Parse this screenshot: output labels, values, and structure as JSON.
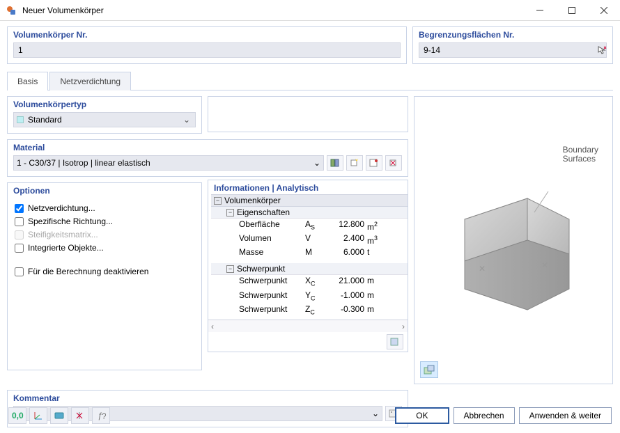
{
  "window": {
    "title": "Neuer Volumenkörper"
  },
  "top": {
    "nr_label": "Volumenkörper Nr.",
    "nr_value": "1",
    "surf_label": "Begrenzungsflächen Nr.",
    "surf_value": "9-14"
  },
  "tabs": {
    "basis": "Basis",
    "mesh": "Netzverdichtung"
  },
  "type": {
    "label": "Volumenkörpertyp",
    "value": "Standard"
  },
  "material": {
    "label": "Material",
    "value": "1 - C30/37 | Isotrop | linear elastisch"
  },
  "options": {
    "label": "Optionen",
    "mesh": "Netzverdichtung...",
    "dir": "Spezifische Richtung...",
    "stiff": "Steifigkeitsmatrix...",
    "intobj": "Integrierte Objekte...",
    "deact": "Für die Berechnung deaktivieren"
  },
  "info": {
    "label": "Informationen | Analytisch",
    "solid": "Volumenkörper",
    "props": "Eigenschaften",
    "surface": {
      "name": "Oberfläche",
      "sym": "A",
      "sub": "S",
      "val": "12.800",
      "unit": "m",
      "sup": "2"
    },
    "volume": {
      "name": "Volumen",
      "sym": "V",
      "val": "2.400",
      "unit": "m",
      "sup": "3"
    },
    "mass": {
      "name": "Masse",
      "sym": "M",
      "val": "6.000",
      "unit": "t"
    },
    "cog": "Schwerpunkt",
    "xc": {
      "name": "Schwerpunkt",
      "sym": "X",
      "sub": "C",
      "val": "21.000",
      "unit": "m"
    },
    "yc": {
      "name": "Schwerpunkt",
      "sym": "Y",
      "sub": "C",
      "val": "-1.000",
      "unit": "m"
    },
    "zc": {
      "name": "Schwerpunkt",
      "sym": "Z",
      "sub": "C",
      "val": "-0.300",
      "unit": "m"
    }
  },
  "comment": {
    "label": "Kommentar"
  },
  "preview": {
    "label1": "Boundary",
    "label2": "Surfaces"
  },
  "buttons": {
    "ok": "OK",
    "cancel": "Abbrechen",
    "apply": "Anwenden & weiter"
  }
}
